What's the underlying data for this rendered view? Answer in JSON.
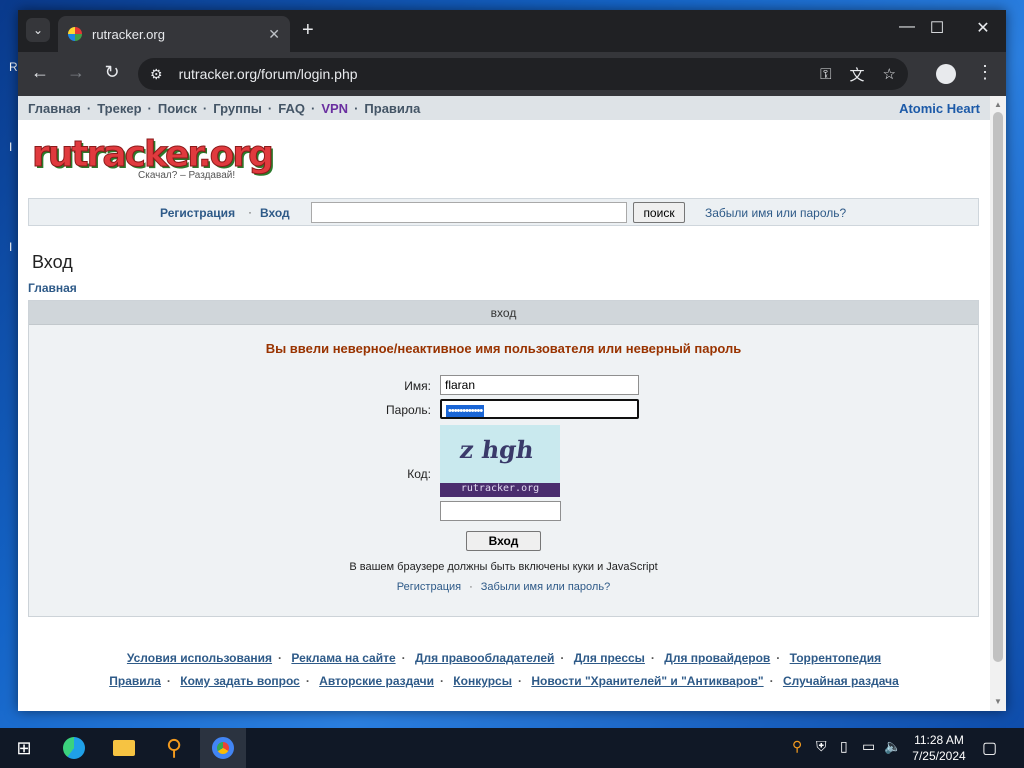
{
  "browser": {
    "tab_title": "rutracker.org",
    "url": "rutracker.org/forum/login.php",
    "new_tab_symbol": "+",
    "icons": [
      "tab-search-icon",
      "favicon-icon",
      "close-icon",
      "back-icon",
      "forward-icon",
      "reload-icon",
      "site-settings-icon",
      "password-key-icon",
      "translate-icon",
      "bookmark-star-icon",
      "profile-icon",
      "menu-icon",
      "minimize-icon",
      "maximize-icon",
      "close-window-icon"
    ]
  },
  "topnav": {
    "items": [
      "Главная",
      "Трекер",
      "Поиск",
      "Группы",
      "FAQ",
      "VPN",
      "Правила"
    ],
    "right_link": "Atomic Heart"
  },
  "logo": {
    "text": "rutracker.org",
    "slogan": "Скачал? – Раздавай!"
  },
  "searchbar": {
    "register": "Регистрация",
    "login": "Вход",
    "button": "поиск",
    "forgot": "Забыли имя или пароль?",
    "query": ""
  },
  "page": {
    "heading": "Вход",
    "breadcrumb": "Главная"
  },
  "login_form": {
    "header": "вход",
    "error": "Вы ввели неверное/неактивное имя пользователя или неверный пароль",
    "username_label": "Имя:",
    "username_value": "flaran",
    "password_label": "Пароль:",
    "password_mask": "••••••••••••",
    "code_label": "Код:",
    "captcha_text": "z hgh",
    "captcha_site": "rutracker.org",
    "code_value": "",
    "submit": "Вход",
    "note": "В вашем браузере должны быть включены куки и JavaScript",
    "register": "Регистрация",
    "forgot": "Забыли имя или пароль?"
  },
  "footer": {
    "row1": [
      "Условия использования",
      "Реклама на сайте",
      "Для правообладателей",
      "Для прессы",
      "Для провайдеров",
      "Торрентопедия"
    ],
    "row2": [
      "Правила",
      "Кому задать вопрос",
      "Авторские раздачи",
      "Конкурсы",
      "Новости \"Хранителей\" и \"Антикваров\"",
      "Случайная раздача"
    ]
  },
  "taskbar": {
    "time": "11:28 AM",
    "date": "7/25/2024",
    "apps": [
      "start-icon",
      "edge-icon",
      "file-explorer-icon",
      "search-app-icon",
      "chrome-icon"
    ]
  },
  "colors": {
    "link": "#2e5a88",
    "error": "#993300",
    "vpn": "#6a2fa0",
    "nav_bg": "#dee3e7"
  }
}
